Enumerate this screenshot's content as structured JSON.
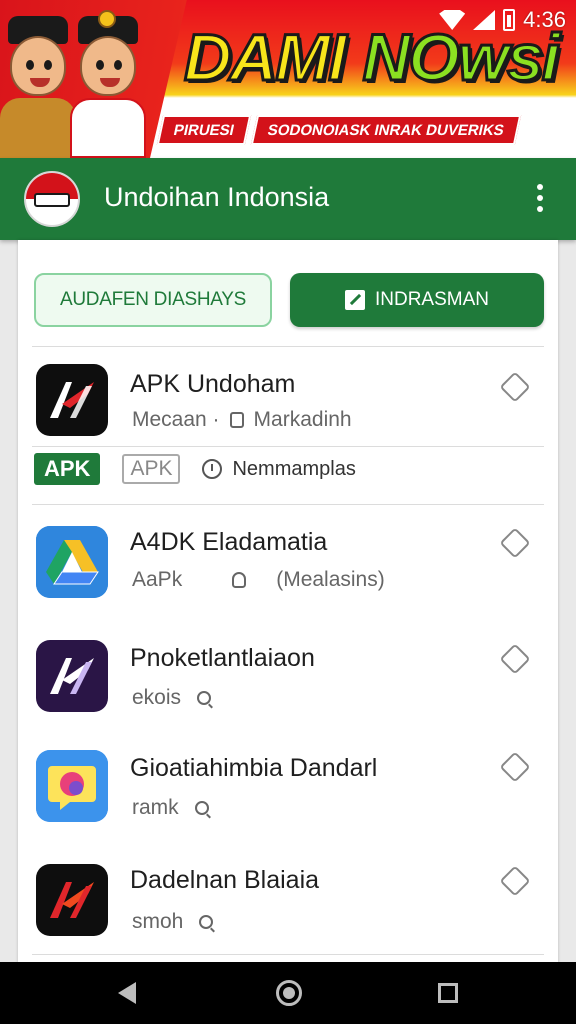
{
  "banner": {
    "headline_1": "DAMI",
    "headline_2": "NOwsi",
    "ribbon_1": "PIRUESI",
    "ribbon_2": "SODONOIASK INRAK DUVERIKS"
  },
  "status_bar": {
    "time": "4:36"
  },
  "app_bar": {
    "title": "Undoihan Indonsia"
  },
  "actions": {
    "outline_button": "AUDAFEN DIASHAYS",
    "filled_button": "INDRASMAN"
  },
  "apps": [
    {
      "name": "APK Undoham",
      "meta_1": "Mecaan ·",
      "meta_2": "Markadinh"
    },
    {
      "name": "A4DK Eladamatia",
      "meta_1": "AaPk",
      "meta_2": "(Mealasins)"
    },
    {
      "name": "Pnoketlantlaiaon",
      "meta_1": "ekois"
    },
    {
      "name": "Gioatiahimbia Dandarl",
      "meta_1": "ramk"
    },
    {
      "name": "Dadelnan Blaiaia",
      "meta_1": "smoh"
    }
  ],
  "tags": {
    "apk_filled": "APK",
    "apk_outline": "APK",
    "tag_text": "Nemmamplas"
  },
  "colors": {
    "brand_green": "#1f7a3a",
    "banner_red": "#d3121a",
    "banner_yellow": "#f7e51b"
  },
  "icons": {
    "favorite": "diamond-outline-icon",
    "menu": "overflow-menu-icon",
    "edit": "edit-icon"
  }
}
